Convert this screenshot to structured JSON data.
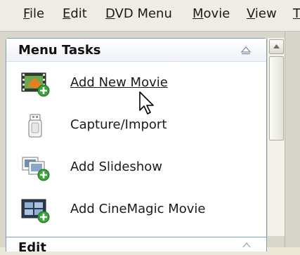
{
  "menubar": {
    "items": [
      {
        "label": "File",
        "u": "F",
        "rest": "ile"
      },
      {
        "label": "Edit",
        "u": "E",
        "rest": "dit"
      },
      {
        "label": "DVD Menu",
        "u": "D",
        "rest": "VD Menu"
      },
      {
        "label": "Movie",
        "u": "M",
        "rest": "ovie"
      },
      {
        "label": "View",
        "u": "V",
        "rest": "iew"
      },
      {
        "label": "T",
        "u": "T",
        "rest": ""
      }
    ]
  },
  "panel": {
    "title": "Menu Tasks",
    "tasks": [
      {
        "label": "Add New Movie",
        "icon": "add-movie-icon",
        "hovered": true
      },
      {
        "label": "Capture/Import",
        "icon": "usb-device-icon",
        "hovered": false
      },
      {
        "label": "Add Slideshow",
        "icon": "add-slideshow-icon",
        "hovered": false
      },
      {
        "label": "Add CineMagic Movie",
        "icon": "add-cinemagic-icon",
        "hovered": false
      }
    ]
  },
  "lower_panel": {
    "title": "Edit"
  },
  "colors": {
    "panel_border": "#7f9db9",
    "accent_green": "#3aa43a",
    "background": "#ece9d8"
  }
}
